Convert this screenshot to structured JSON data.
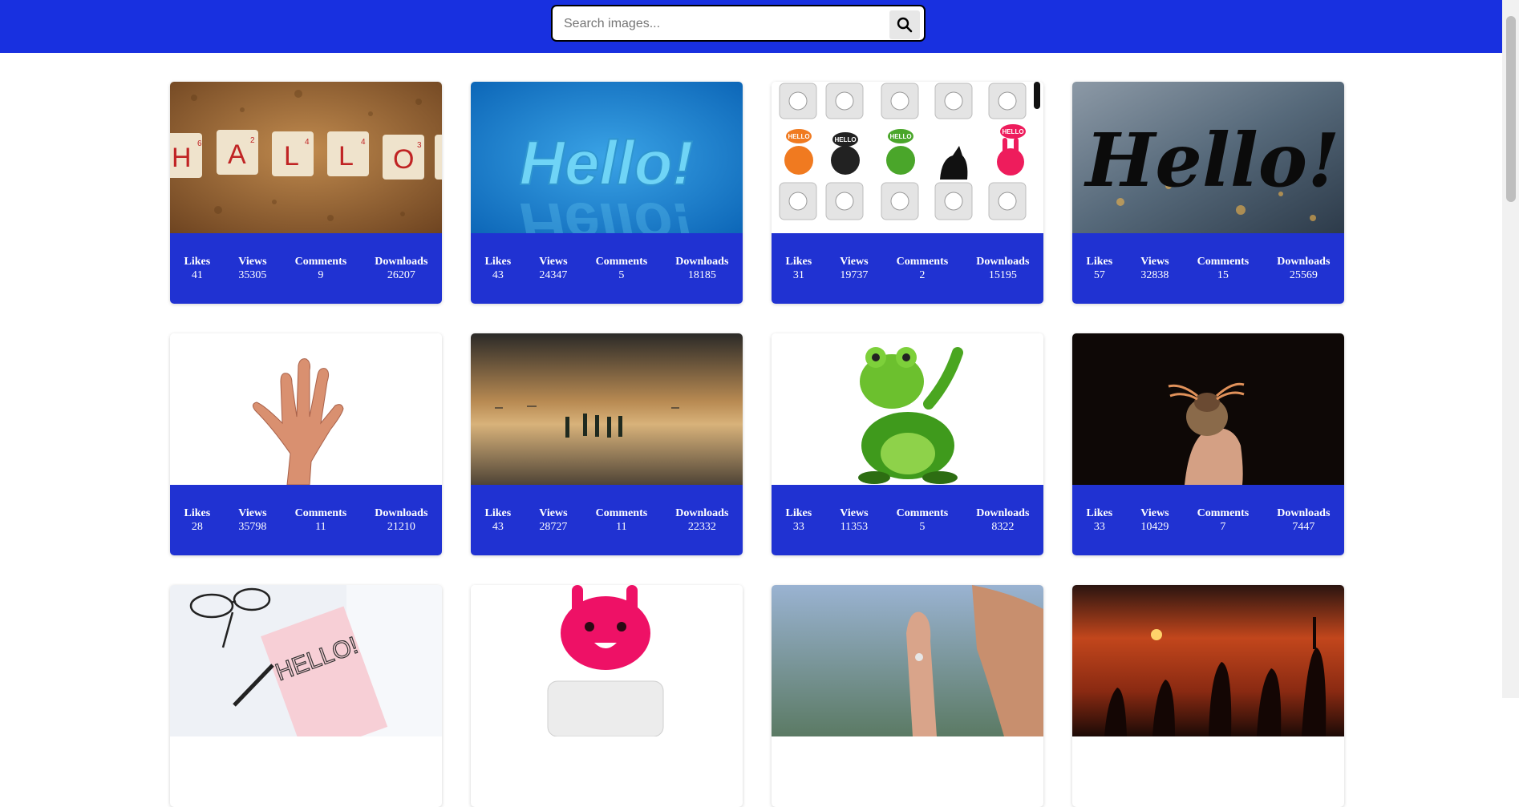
{
  "search": {
    "placeholder": "Search images..."
  },
  "stat_labels": {
    "likes": "Likes",
    "views": "Views",
    "comments": "Comments",
    "downloads": "Downloads"
  },
  "images": [
    {
      "likes": "41",
      "views": "35305",
      "comments": "9",
      "downloads": "26207",
      "thumb_text": "H6A2L4L4O3"
    },
    {
      "likes": "43",
      "views": "24347",
      "comments": "5",
      "downloads": "18185",
      "thumb_text": "Hello!"
    },
    {
      "likes": "31",
      "views": "19737",
      "comments": "2",
      "downloads": "15195",
      "thumb_text": "HELLO"
    },
    {
      "likes": "57",
      "views": "32838",
      "comments": "15",
      "downloads": "25569",
      "thumb_text": "Hello!"
    },
    {
      "likes": "28",
      "views": "35798",
      "comments": "11",
      "downloads": "21210"
    },
    {
      "likes": "43",
      "views": "28727",
      "comments": "11",
      "downloads": "22332"
    },
    {
      "likes": "33",
      "views": "11353",
      "comments": "5",
      "downloads": "8322"
    },
    {
      "likes": "33",
      "views": "10429",
      "comments": "7",
      "downloads": "7447"
    },
    {
      "thumb_text": "HELLO!"
    },
    {},
    {},
    {}
  ]
}
